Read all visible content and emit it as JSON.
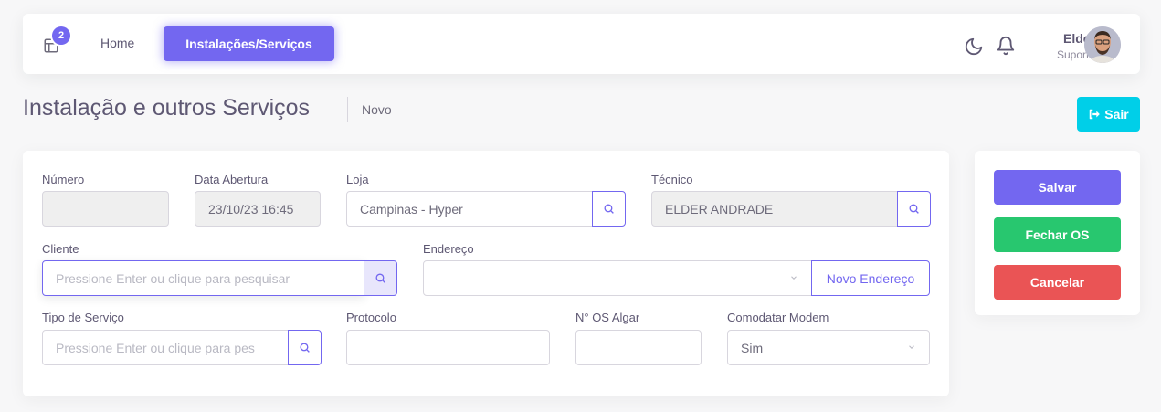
{
  "navbar": {
    "badge_count": "2",
    "home_label": "Home",
    "active_label": "Instalações/Serviços",
    "user_name": "Elder",
    "user_role": "Suporte"
  },
  "page": {
    "title": "Instalação e outros Serviços",
    "breadcrumb": "Novo",
    "exit_label": "Sair"
  },
  "form": {
    "numero": {
      "label": "Número",
      "value": ""
    },
    "data_abertura": {
      "label": "Data Abertura",
      "value": "23/10/23 16:45"
    },
    "loja": {
      "label": "Loja",
      "value": "Campinas - Hyper"
    },
    "tecnico": {
      "label": "Técnico",
      "value": "ELDER ANDRADE"
    },
    "cliente": {
      "label": "Cliente",
      "placeholder": "Pressione Enter ou clique para pesquisar"
    },
    "endereco": {
      "label": "Endereço",
      "value": "",
      "new_label": "Novo Endereço"
    },
    "tipo_servico": {
      "label": "Tipo de Serviço",
      "placeholder": "Pressione Enter ou clique para pes"
    },
    "protocolo": {
      "label": "Protocolo",
      "value": ""
    },
    "os_algar": {
      "label": "N° OS Algar",
      "value": ""
    },
    "comodato": {
      "label": "Comodatar Modem",
      "value": "Sim"
    }
  },
  "actions": {
    "save_label": "Salvar",
    "close_label": "Fechar OS",
    "cancel_label": "Cancelar"
  },
  "colors": {
    "primary": "#7367f0",
    "info": "#00cfe8",
    "success": "#28c76f",
    "danger": "#ea5455"
  }
}
